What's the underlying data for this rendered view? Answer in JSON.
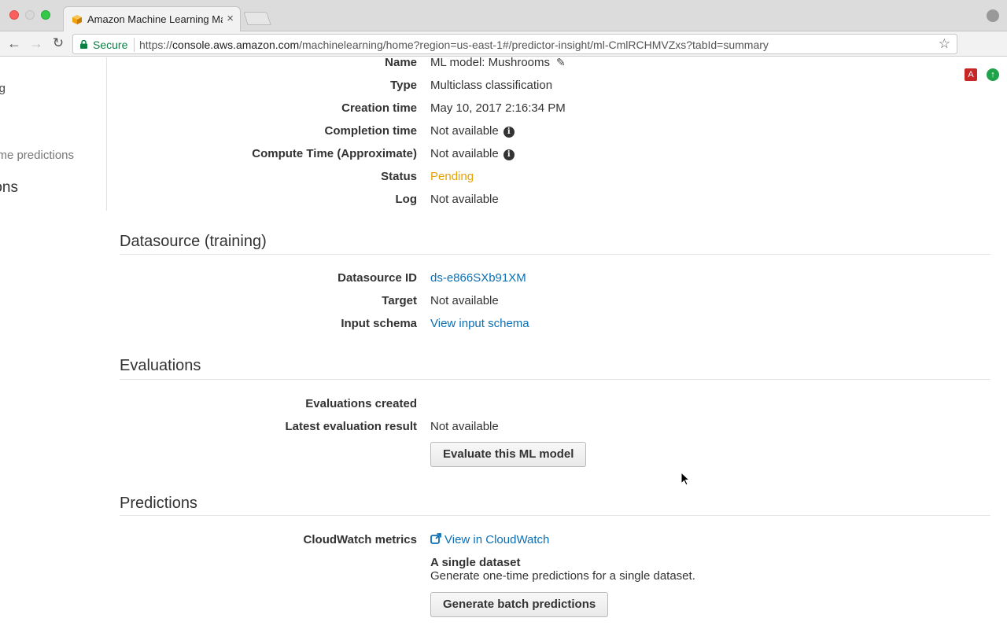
{
  "browser": {
    "tab_title": "Amazon Machine Learning Ma",
    "tab_close": "×",
    "secure_label": "Secure",
    "url_scheme": "https://",
    "url_host": "console.aws.amazon.com",
    "url_path": "/machinelearning/home?region=us-east-1#/predictor-insight/ml-CmlRCHMVZxs?tabId=summary",
    "star": "☆",
    "ext_pdf": "A",
    "ext_up": "↑"
  },
  "sidebar": {
    "item_a": "g",
    "item_b": "me predictions",
    "item_c": "ons"
  },
  "model": {
    "name_label": "Name",
    "name_value": "ML model: Mushrooms",
    "type_label": "Type",
    "type_value": "Multiclass classification",
    "creation_label": "Creation time",
    "creation_value": "May 10, 2017 2:16:34 PM",
    "completion_label": "Completion time",
    "completion_value": "Not available",
    "compute_label": "Compute Time (Approximate)",
    "compute_value": "Not available",
    "status_label": "Status",
    "status_value": "Pending",
    "log_label": "Log",
    "log_value": "Not available"
  },
  "datasource": {
    "title": "Datasource (training)",
    "id_label": "Datasource ID",
    "id_value": "ds-e866SXb91XM",
    "target_label": "Target",
    "target_value": "Not available",
    "schema_label": "Input schema",
    "schema_value": "View input schema"
  },
  "evaluations": {
    "title": "Evaluations",
    "created_label": "Evaluations created",
    "latest_label": "Latest evaluation result",
    "latest_value": "Not available",
    "evaluate_button": "Evaluate this ML model"
  },
  "predictions": {
    "title": "Predictions",
    "cloudwatch_label": "CloudWatch metrics",
    "cloudwatch_link": "View in CloudWatch",
    "single_title": "A single dataset",
    "single_desc": "Generate one-time predictions for a single dataset.",
    "batch_button": "Generate batch predictions"
  },
  "colors": {
    "link": "#0b6fb5",
    "pending": "#e8a200",
    "secure": "#0b8043"
  }
}
